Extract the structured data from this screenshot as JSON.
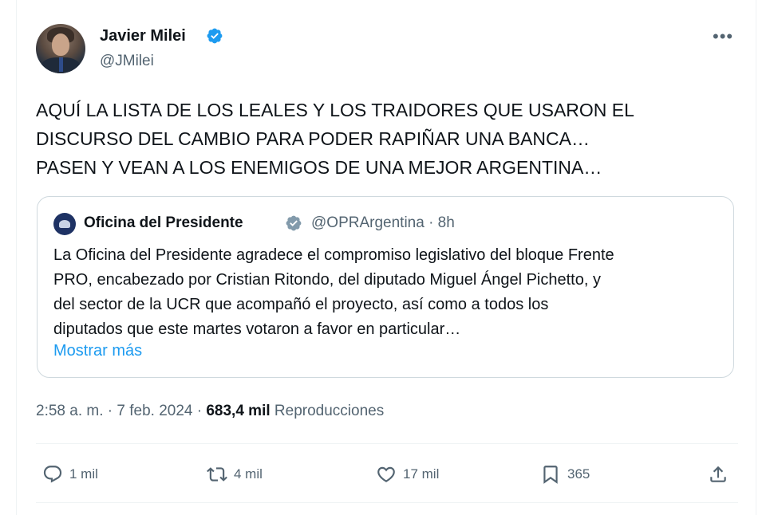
{
  "author": {
    "name": "Javier Milei",
    "handle": "@JMilei"
  },
  "menu_icon": "more-horizontal-icon",
  "tweet": {
    "lines": [
      "AQUÍ LA LISTA DE LOS LEALES Y LOS TRAIDORES QUE USARON EL",
      "DISCURSO DEL CAMBIO PARA PODER RAPIÑAR UNA BANCA…",
      "PASEN Y VEAN A LOS ENEMIGOS DE UNA MEJOR ARGENTINA…"
    ]
  },
  "quote": {
    "name": "Oficina del Presidente",
    "handle": "@OPRArgentina",
    "time": "· 8h",
    "lines": [
      "La Oficina del Presidente agradece el compromiso legislativo del bloque Frente",
      "PRO, encabezado por Cristian Ritondo, del diputado Miguel Ángel Pichetto, y",
      "del sector de la UCR que acompañó el proyecto, así como a todos los",
      "diputados que este martes votaron a favor en particular…"
    ],
    "show_more": "Mostrar más"
  },
  "meta": {
    "time": "2:58 a. m. · 7 feb. 2024 ·",
    "views": "683,4 mil",
    "views_label": "Reproducciones"
  },
  "actions": {
    "replies": "1 mil",
    "retweets": "4 mil",
    "likes": "17 mil",
    "bookmarks": "365"
  },
  "colors": {
    "verified_blue": "#1d9bf0",
    "verified_gray": "#829aab",
    "link": "#1d9bf0",
    "secondary_text": "#536471"
  }
}
